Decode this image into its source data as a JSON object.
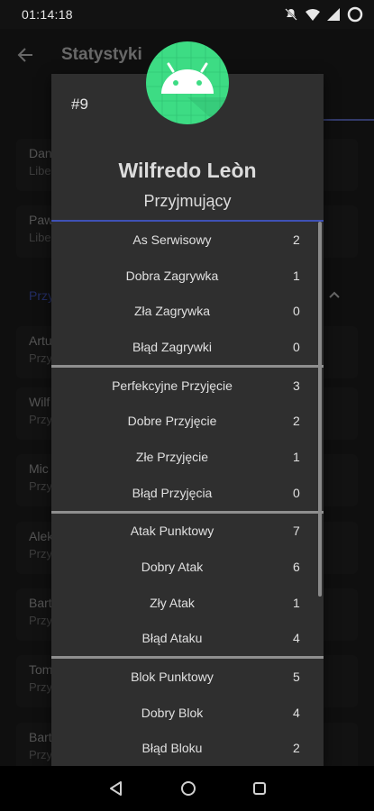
{
  "status_bar": {
    "time": "01:14:18"
  },
  "background": {
    "title": "Statystyki",
    "cards": [
      {
        "name": "Dan",
        "sub": "Libe"
      },
      {
        "name": "Paw",
        "sub": "Libe"
      },
      {
        "name": "Artu",
        "sub": "Przy"
      },
      {
        "name": "Wilf",
        "sub": "Przy"
      },
      {
        "name": "Mic",
        "sub": "Przy"
      },
      {
        "name": "Alek",
        "sub": "Przy"
      },
      {
        "name": "Bart",
        "sub": "Przy"
      },
      {
        "name": "Tom",
        "sub": "Przy"
      },
      {
        "name": "Bart",
        "sub": "Przy"
      }
    ],
    "section_label": "Przy"
  },
  "dialog": {
    "number": "#9",
    "name": "Wilfredo Leòn",
    "role": "Przyjmujący",
    "groups": [
      [
        {
          "label": "As Serwisowy",
          "value": "2"
        },
        {
          "label": "Dobra Zagrywka",
          "value": "1"
        },
        {
          "label": "Zła Zagrywka",
          "value": "0"
        },
        {
          "label": "Błąd Zagrywki",
          "value": "0"
        }
      ],
      [
        {
          "label": "Perfekcyjne Przyjęcie",
          "value": "3"
        },
        {
          "label": "Dobre Przyjęcie",
          "value": "2"
        },
        {
          "label": "Złe Przyjęcie",
          "value": "1"
        },
        {
          "label": "Błąd Przyjęcia",
          "value": "0"
        }
      ],
      [
        {
          "label": "Atak Punktowy",
          "value": "7"
        },
        {
          "label": "Dobry Atak",
          "value": "6"
        },
        {
          "label": "Zły Atak",
          "value": "1"
        },
        {
          "label": "Błąd Ataku",
          "value": "4"
        }
      ],
      [
        {
          "label": "Blok Punktowy",
          "value": "5"
        },
        {
          "label": "Dobry Blok",
          "value": "4"
        },
        {
          "label": "Błąd Bloku",
          "value": "2"
        }
      ]
    ]
  },
  "colors": {
    "accent": "#3f51b5",
    "android_green": "#3ddc84"
  }
}
